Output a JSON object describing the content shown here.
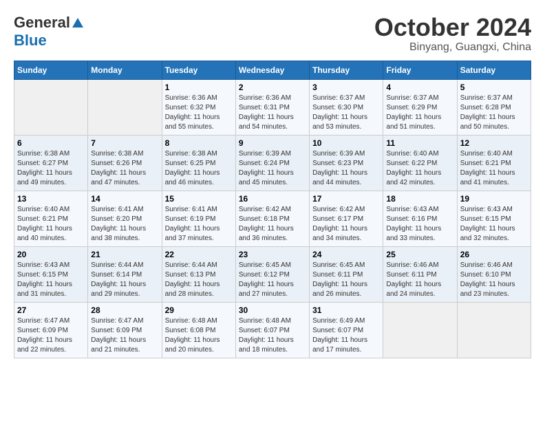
{
  "header": {
    "logo_general": "General",
    "logo_blue": "Blue",
    "month_title": "October 2024",
    "location": "Binyang, Guangxi, China"
  },
  "days_of_week": [
    "Sunday",
    "Monday",
    "Tuesday",
    "Wednesday",
    "Thursday",
    "Friday",
    "Saturday"
  ],
  "weeks": [
    [
      {
        "num": "",
        "sunrise": "",
        "sunset": "",
        "daylight": ""
      },
      {
        "num": "",
        "sunrise": "",
        "sunset": "",
        "daylight": ""
      },
      {
        "num": "1",
        "sunrise": "Sunrise: 6:36 AM",
        "sunset": "Sunset: 6:32 PM",
        "daylight": "Daylight: 11 hours and 55 minutes."
      },
      {
        "num": "2",
        "sunrise": "Sunrise: 6:36 AM",
        "sunset": "Sunset: 6:31 PM",
        "daylight": "Daylight: 11 hours and 54 minutes."
      },
      {
        "num": "3",
        "sunrise": "Sunrise: 6:37 AM",
        "sunset": "Sunset: 6:30 PM",
        "daylight": "Daylight: 11 hours and 53 minutes."
      },
      {
        "num": "4",
        "sunrise": "Sunrise: 6:37 AM",
        "sunset": "Sunset: 6:29 PM",
        "daylight": "Daylight: 11 hours and 51 minutes."
      },
      {
        "num": "5",
        "sunrise": "Sunrise: 6:37 AM",
        "sunset": "Sunset: 6:28 PM",
        "daylight": "Daylight: 11 hours and 50 minutes."
      }
    ],
    [
      {
        "num": "6",
        "sunrise": "Sunrise: 6:38 AM",
        "sunset": "Sunset: 6:27 PM",
        "daylight": "Daylight: 11 hours and 49 minutes."
      },
      {
        "num": "7",
        "sunrise": "Sunrise: 6:38 AM",
        "sunset": "Sunset: 6:26 PM",
        "daylight": "Daylight: 11 hours and 47 minutes."
      },
      {
        "num": "8",
        "sunrise": "Sunrise: 6:38 AM",
        "sunset": "Sunset: 6:25 PM",
        "daylight": "Daylight: 11 hours and 46 minutes."
      },
      {
        "num": "9",
        "sunrise": "Sunrise: 6:39 AM",
        "sunset": "Sunset: 6:24 PM",
        "daylight": "Daylight: 11 hours and 45 minutes."
      },
      {
        "num": "10",
        "sunrise": "Sunrise: 6:39 AM",
        "sunset": "Sunset: 6:23 PM",
        "daylight": "Daylight: 11 hours and 44 minutes."
      },
      {
        "num": "11",
        "sunrise": "Sunrise: 6:40 AM",
        "sunset": "Sunset: 6:22 PM",
        "daylight": "Daylight: 11 hours and 42 minutes."
      },
      {
        "num": "12",
        "sunrise": "Sunrise: 6:40 AM",
        "sunset": "Sunset: 6:21 PM",
        "daylight": "Daylight: 11 hours and 41 minutes."
      }
    ],
    [
      {
        "num": "13",
        "sunrise": "Sunrise: 6:40 AM",
        "sunset": "Sunset: 6:21 PM",
        "daylight": "Daylight: 11 hours and 40 minutes."
      },
      {
        "num": "14",
        "sunrise": "Sunrise: 6:41 AM",
        "sunset": "Sunset: 6:20 PM",
        "daylight": "Daylight: 11 hours and 38 minutes."
      },
      {
        "num": "15",
        "sunrise": "Sunrise: 6:41 AM",
        "sunset": "Sunset: 6:19 PM",
        "daylight": "Daylight: 11 hours and 37 minutes."
      },
      {
        "num": "16",
        "sunrise": "Sunrise: 6:42 AM",
        "sunset": "Sunset: 6:18 PM",
        "daylight": "Daylight: 11 hours and 36 minutes."
      },
      {
        "num": "17",
        "sunrise": "Sunrise: 6:42 AM",
        "sunset": "Sunset: 6:17 PM",
        "daylight": "Daylight: 11 hours and 34 minutes."
      },
      {
        "num": "18",
        "sunrise": "Sunrise: 6:43 AM",
        "sunset": "Sunset: 6:16 PM",
        "daylight": "Daylight: 11 hours and 33 minutes."
      },
      {
        "num": "19",
        "sunrise": "Sunrise: 6:43 AM",
        "sunset": "Sunset: 6:15 PM",
        "daylight": "Daylight: 11 hours and 32 minutes."
      }
    ],
    [
      {
        "num": "20",
        "sunrise": "Sunrise: 6:43 AM",
        "sunset": "Sunset: 6:15 PM",
        "daylight": "Daylight: 11 hours and 31 minutes."
      },
      {
        "num": "21",
        "sunrise": "Sunrise: 6:44 AM",
        "sunset": "Sunset: 6:14 PM",
        "daylight": "Daylight: 11 hours and 29 minutes."
      },
      {
        "num": "22",
        "sunrise": "Sunrise: 6:44 AM",
        "sunset": "Sunset: 6:13 PM",
        "daylight": "Daylight: 11 hours and 28 minutes."
      },
      {
        "num": "23",
        "sunrise": "Sunrise: 6:45 AM",
        "sunset": "Sunset: 6:12 PM",
        "daylight": "Daylight: 11 hours and 27 minutes."
      },
      {
        "num": "24",
        "sunrise": "Sunrise: 6:45 AM",
        "sunset": "Sunset: 6:11 PM",
        "daylight": "Daylight: 11 hours and 26 minutes."
      },
      {
        "num": "25",
        "sunrise": "Sunrise: 6:46 AM",
        "sunset": "Sunset: 6:11 PM",
        "daylight": "Daylight: 11 hours and 24 minutes."
      },
      {
        "num": "26",
        "sunrise": "Sunrise: 6:46 AM",
        "sunset": "Sunset: 6:10 PM",
        "daylight": "Daylight: 11 hours and 23 minutes."
      }
    ],
    [
      {
        "num": "27",
        "sunrise": "Sunrise: 6:47 AM",
        "sunset": "Sunset: 6:09 PM",
        "daylight": "Daylight: 11 hours and 22 minutes."
      },
      {
        "num": "28",
        "sunrise": "Sunrise: 6:47 AM",
        "sunset": "Sunset: 6:09 PM",
        "daylight": "Daylight: 11 hours and 21 minutes."
      },
      {
        "num": "29",
        "sunrise": "Sunrise: 6:48 AM",
        "sunset": "Sunset: 6:08 PM",
        "daylight": "Daylight: 11 hours and 20 minutes."
      },
      {
        "num": "30",
        "sunrise": "Sunrise: 6:48 AM",
        "sunset": "Sunset: 6:07 PM",
        "daylight": "Daylight: 11 hours and 18 minutes."
      },
      {
        "num": "31",
        "sunrise": "Sunrise: 6:49 AM",
        "sunset": "Sunset: 6:07 PM",
        "daylight": "Daylight: 11 hours and 17 minutes."
      },
      {
        "num": "",
        "sunrise": "",
        "sunset": "",
        "daylight": ""
      },
      {
        "num": "",
        "sunrise": "",
        "sunset": "",
        "daylight": ""
      }
    ]
  ]
}
